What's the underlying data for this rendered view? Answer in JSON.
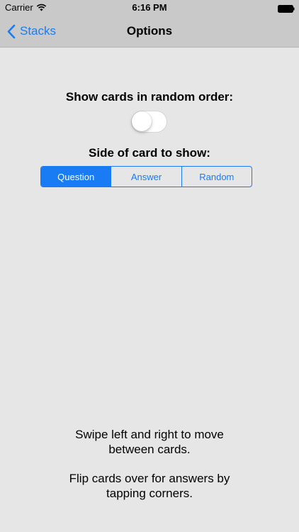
{
  "status_bar": {
    "carrier": "Carrier",
    "time": "6:16 PM",
    "icons": [
      "wifi-icon",
      "battery-icon"
    ]
  },
  "nav": {
    "back_label": "Stacks",
    "title": "Options"
  },
  "options": {
    "random_order_label": "Show cards in random order:",
    "random_order_enabled": false,
    "side_label": "Side of card to show:",
    "segments": [
      "Question",
      "Answer",
      "Random"
    ],
    "selected_segment": "Question"
  },
  "instructions": {
    "swipe": "Swipe left and right to move between cards.",
    "flip": "Flip cards over for answers by tapping corners."
  },
  "colors": {
    "accent": "#1a7cf5",
    "nav_background": "#c9c9c9",
    "page_background": "#e6e6e6"
  }
}
